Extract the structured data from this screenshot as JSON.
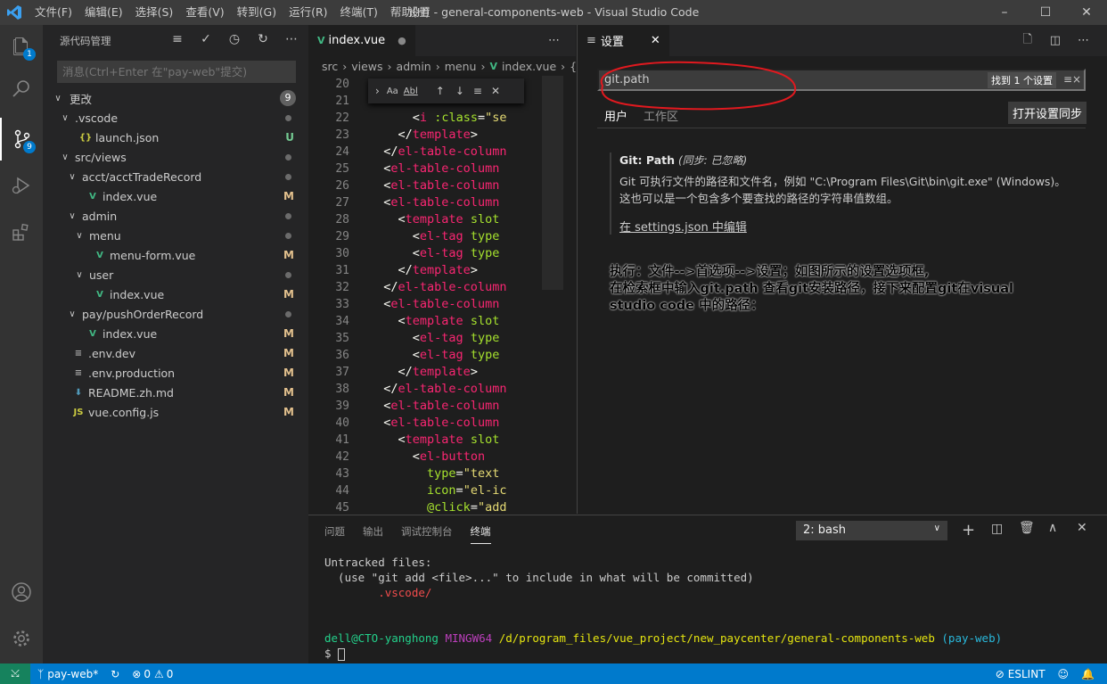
{
  "window": {
    "menus": [
      "文件(F)",
      "编辑(E)",
      "选择(S)",
      "查看(V)",
      "转到(G)",
      "运行(R)",
      "终端(T)",
      "帮助(H)"
    ],
    "title": "设置 - general-components-web - Visual Studio Code"
  },
  "activity": {
    "explorer_badge": "1",
    "scm_badge": "9"
  },
  "sidebar": {
    "title": "源代码管理",
    "commit_placeholder": "消息(Ctrl+Enter 在\"pay-web\"提交)",
    "changes_label": "更改",
    "changes_count": "9",
    "tree": [
      {
        "label": ".vscode",
        "indent": 1,
        "type": "folder",
        "status": "dot"
      },
      {
        "label": "launch.json",
        "indent": 2,
        "type": "json",
        "status": "U"
      },
      {
        "label": "src/views",
        "indent": 1,
        "type": "folder",
        "status": "dot"
      },
      {
        "label": "acct/acctTradeRecord",
        "indent": 2,
        "type": "folder",
        "status": "dot"
      },
      {
        "label": "index.vue",
        "indent": 3,
        "type": "vue",
        "status": "M"
      },
      {
        "label": "admin",
        "indent": 2,
        "type": "folder",
        "status": "dot"
      },
      {
        "label": "menu",
        "indent": 3,
        "type": "folder",
        "status": "dot"
      },
      {
        "label": "menu-form.vue",
        "indent": 4,
        "type": "vue",
        "status": "M"
      },
      {
        "label": "user",
        "indent": 3,
        "type": "folder",
        "status": "dot"
      },
      {
        "label": "index.vue",
        "indent": 4,
        "type": "vue",
        "status": "M"
      },
      {
        "label": "pay/pushOrderRecord",
        "indent": 2,
        "type": "folder",
        "status": "dot"
      },
      {
        "label": "index.vue",
        "indent": 3,
        "type": "vue",
        "status": "M"
      },
      {
        "label": ".env.dev",
        "indent": 1,
        "type": "env",
        "status": "M"
      },
      {
        "label": ".env.production",
        "indent": 1,
        "type": "env",
        "status": "M"
      },
      {
        "label": "README.zh.md",
        "indent": 1,
        "type": "md",
        "status": "M"
      },
      {
        "label": "vue.config.js",
        "indent": 1,
        "type": "js",
        "status": "M"
      }
    ]
  },
  "editor1": {
    "tab_label": "index.vue",
    "breadcrumbs": [
      "src",
      "views",
      "admin",
      "menu",
      "index.vue",
      "{}"
    ],
    "line_numbers": [
      "20",
      "21",
      "22",
      "23",
      "24",
      "25",
      "26",
      "27",
      "28",
      "29",
      "30",
      "31",
      "32",
      "33",
      "34",
      "35",
      "36",
      "37",
      "38",
      "39",
      "40",
      "41",
      "42",
      "43",
      "44",
      "45"
    ],
    "find_widget": {
      "match_case": "Aa",
      "whole_word": "Abl"
    }
  },
  "settings": {
    "tab_label": "设置",
    "search_value": "git.path",
    "found_label": "找到 1 个设置",
    "scope_user": "用户",
    "scope_workspace": "工作区",
    "sync_button": "打开设置同步",
    "setting_title": "Git: Path",
    "setting_sync": "(同步: 已忽略)",
    "setting_desc": "Git 可执行文件的路径和文件名，例如 \"C:\\Program Files\\Git\\bin\\git.exe\" (Windows)。这也可以是一个包含多个要查找的路径的字符串值数组。",
    "edit_link": "在 settings.json 中编辑",
    "note_line1": "执行：文件-->首选项-->设置；如图所示的设置选项框,",
    "note_line2": "在检索框中输入git.path 查看git安装路径，接下来配置git在visual",
    "note_line3": "studio code 中的路径："
  },
  "panel": {
    "tabs": [
      "问题",
      "输出",
      "调试控制台",
      "终端"
    ],
    "terminal_select": "2: bash",
    "term_line1": "Untracked files:",
    "term_line2": "  (use \"git add <file>...\" to include in what will be committed)",
    "term_line3": "        .vscode/",
    "prompt_user": "dell@CTO-yanghong",
    "prompt_env": "MINGW64",
    "prompt_path": "/d/program_files/vue_project/new_paycenter/general-components-web",
    "prompt_branch": "(pay-web)",
    "prompt_symbol": "$"
  },
  "statusbar": {
    "branch": "pay-web*",
    "problems": "0",
    "warnings": "0",
    "eslint": "ESLINT"
  },
  "colors": {
    "accent": "#007acc",
    "annotation_circle": "#e0191f",
    "remote": "#16825d"
  }
}
